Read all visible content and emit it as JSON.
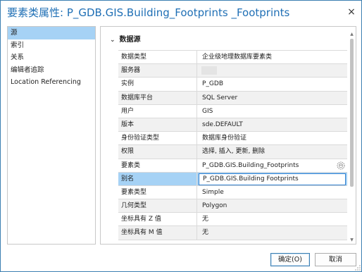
{
  "window": {
    "title": "要素类属性: P_GDB.GIS.Building_Footprints  _Footprints",
    "close_label": "×"
  },
  "nav": {
    "items": [
      {
        "label": "源",
        "selected": true
      },
      {
        "label": "索引"
      },
      {
        "label": "关系"
      },
      {
        "label": "编辑者追踪"
      },
      {
        "label": "Location Referencing"
      }
    ]
  },
  "section": {
    "chevron": "⌄",
    "title": "数据源"
  },
  "properties": [
    {
      "key": "数据类型",
      "value": "企业级地理数据库要素类"
    },
    {
      "key": "服务器",
      "value": "",
      "redacted": true
    },
    {
      "key": "实例",
      "value": "P_GDB"
    },
    {
      "key": "数据库平台",
      "value": "SQL Server"
    },
    {
      "key": "用户",
      "value": "GIS"
    },
    {
      "key": "版本",
      "value": "sde.DEFAULT"
    },
    {
      "key": "身份验证类型",
      "value": "数据库身份验证"
    },
    {
      "key": "权限",
      "value": "选择, 插入, 更新, 删除"
    },
    {
      "key": "要素类",
      "value": "P_GDB.GIS.Building_Footprints",
      "icon": "database-icon"
    },
    {
      "key": "别名",
      "value": "P_GDB.GIS.Building Footprints",
      "editing": true
    },
    {
      "key": "要素类型",
      "value": "Simple"
    },
    {
      "key": "几何类型",
      "value": "Polygon"
    },
    {
      "key": "坐标具有 Z 值",
      "value": "无"
    },
    {
      "key": "坐标具有 M 值",
      "value": "无"
    }
  ],
  "buttons": {
    "ok_label": "确定(O)",
    "cancel_label": "取消"
  },
  "colors": {
    "title": "#1f6fb5",
    "selection": "#a6d2f5",
    "focus_border": "#2f7fcf",
    "dialog_border": "#3c7fb1"
  }
}
